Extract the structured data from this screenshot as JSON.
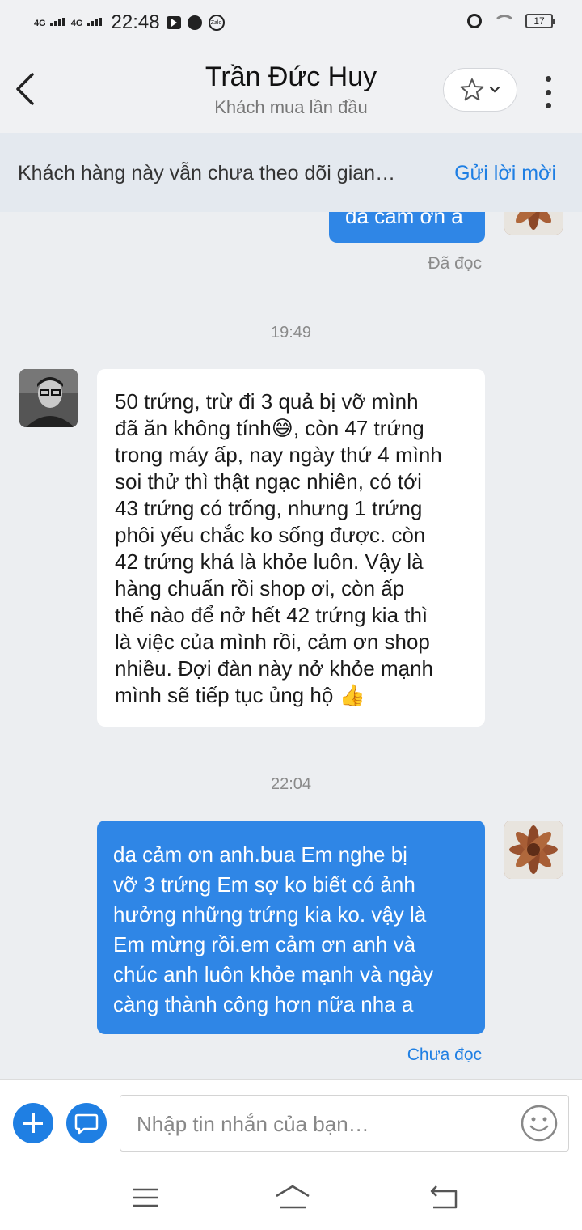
{
  "status_bar": {
    "network1": "4G",
    "network2": "4G",
    "time": "22:48",
    "battery": "17"
  },
  "header": {
    "title": "Trần Đức Huy",
    "subtitle": "Khách mua lần đầu"
  },
  "banner": {
    "text": "Khách hàng này vẫn chưa theo dõi gian…",
    "action": "Gửi lời mời"
  },
  "messages": {
    "top_partial_text": "da cảm ơn a",
    "top_status": "Đã đọc",
    "time1": "19:49",
    "incoming_lines": [
      "50 trứng, trừ đi 3 quả bị vỡ mình",
      "đã ăn không tính😅, còn 47 trứng",
      "trong máy ấp, nay ngày thứ 4 mình",
      "soi thử thì thật ngạc nhiên, có tới",
      "43 trứng có trống, nhưng 1 trứng",
      "phôi yếu chắc ko sống được. còn",
      "42 trứng khá là khỏe luôn. Vậy là",
      "hàng chuẩn rồi shop ơi, còn ấp",
      "thế nào để nở hết 42 trứng kia thì",
      "là việc của mình rồi, cảm ơn shop",
      "nhiều. Đợi đàn này nở khỏe mạnh",
      "mình sẽ tiếp tục ủng hộ 👍"
    ],
    "time2": "22:04",
    "outgoing_lines": [
      "da cảm ơn anh.bua Em nghe bị",
      "vỡ 3 trứng Em sợ ko biết có ảnh",
      "hưởng những trứng kia ko. vậy là",
      "Em mừng rồi.em cảm ơn anh và",
      "chúc anh luôn khỏe mạnh và ngày",
      "càng thành công hơn nữa nha a"
    ],
    "bottom_status": "Chưa đọc"
  },
  "input": {
    "placeholder": "Nhập tin nhắn của bạn…"
  },
  "colors": {
    "accent": "#1f7fe3",
    "outgoing_bubble": "#2f86e6",
    "incoming_bubble": "#ffffff",
    "background": "#eceef1"
  }
}
